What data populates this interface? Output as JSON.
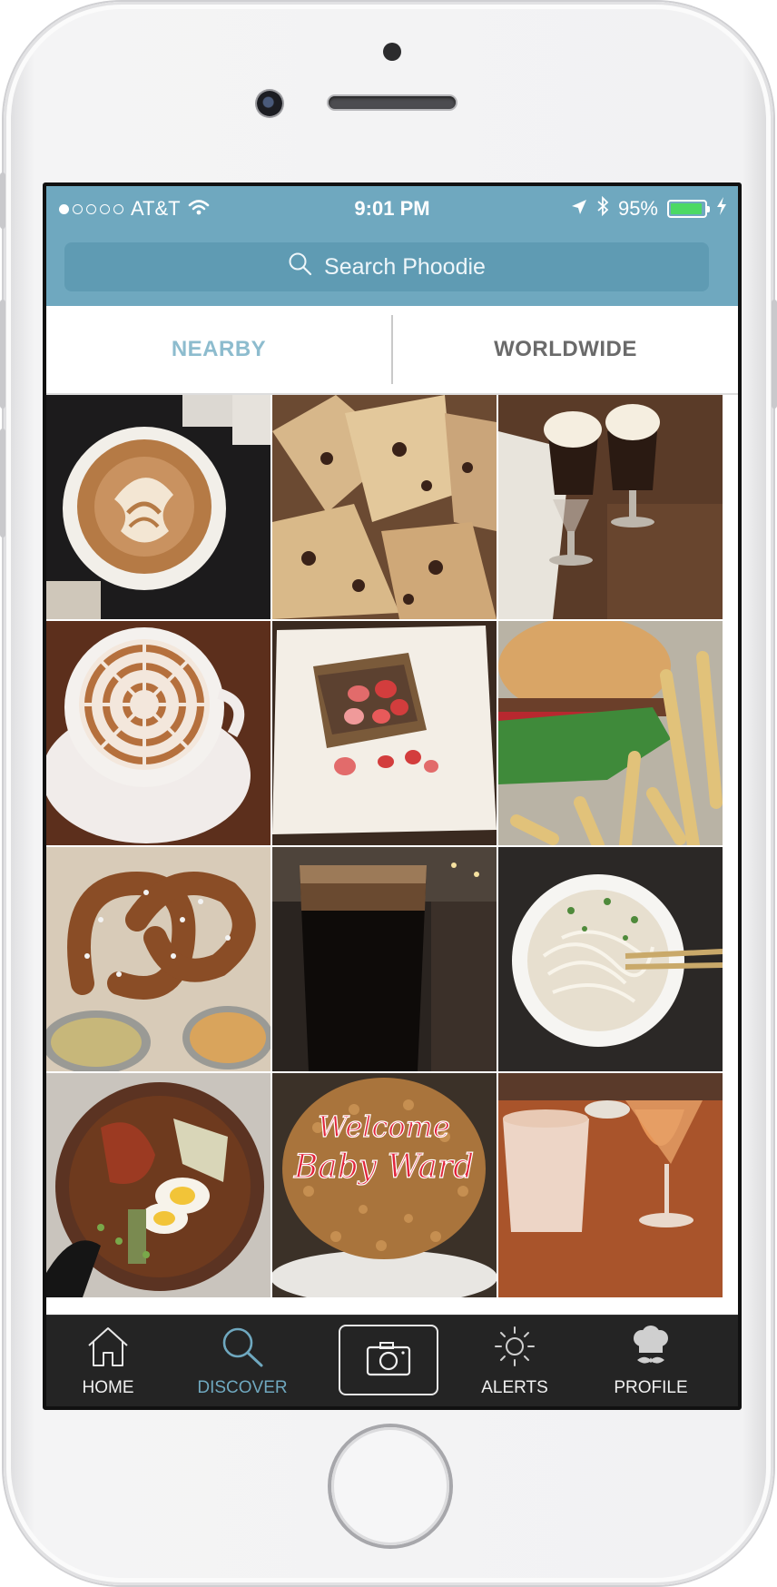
{
  "status_bar": {
    "carrier": "AT&T",
    "time": "9:01 PM",
    "battery": "95%",
    "battery_level": 0.95,
    "signal_dots_filled": 1,
    "signal_dots_total": 5
  },
  "search": {
    "placeholder": "Search Phoodie"
  },
  "tabs": [
    {
      "label": "NEARBY",
      "active": true
    },
    {
      "label": "WORLDWIDE",
      "active": false
    }
  ],
  "photos": [
    {
      "name": "latte-heart",
      "cake_text": ""
    },
    {
      "name": "chocolate-chip-scones",
      "cake_text": ""
    },
    {
      "name": "irish-coffees",
      "cake_text": ""
    },
    {
      "name": "latte-web",
      "cake_text": ""
    },
    {
      "name": "french-toast-strawberries",
      "cake_text": ""
    },
    {
      "name": "burger-and-fries",
      "cake_text": ""
    },
    {
      "name": "pretzel-with-dips",
      "cake_text": ""
    },
    {
      "name": "stout-beer",
      "cake_text": ""
    },
    {
      "name": "pho-bowl",
      "cake_text": ""
    },
    {
      "name": "ramen-bowl",
      "cake_text": ""
    },
    {
      "name": "welcome-cake",
      "cake_text": [
        "Welcome",
        "Baby Ward"
      ]
    },
    {
      "name": "cocktails",
      "cake_text": ""
    }
  ],
  "tabbar": {
    "home": "HOME",
    "discover": "DISCOVER",
    "alerts": "ALERTS",
    "profile": "PROFILE",
    "active": "discover"
  },
  "colors": {
    "header": "#6fa8bf",
    "accent": "#6fa8bf",
    "tabbar": "#242424",
    "battery_fill": "#4cd964"
  }
}
